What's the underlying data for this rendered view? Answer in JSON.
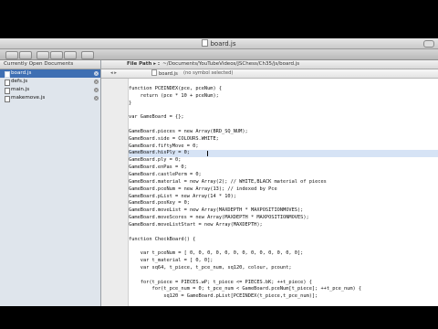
{
  "window": {
    "title": "board.js"
  },
  "sidebar": {
    "header": "Currently Open Documents",
    "files": [
      {
        "name": "board.js",
        "active": true
      },
      {
        "name": "defs.js",
        "active": false
      },
      {
        "name": "main.js",
        "active": false
      },
      {
        "name": "makemove.js",
        "active": false
      }
    ]
  },
  "editor": {
    "path_label": "File Path ▸ :",
    "path_value": "~/Documents/YouTubeVideos/JSChess/Ch35/js/board.js",
    "file_name": "board.js",
    "symbol": "(no symbol selected)",
    "highlight_line": 11,
    "lines": [
      {
        "n": "1",
        "t": ""
      },
      {
        "n": "2",
        "t": "function PCEINDEX(pce, pceNum) {"
      },
      {
        "n": "3",
        "t": "    return (pce * 10 + pceNum);"
      },
      {
        "n": "4",
        "t": "}"
      },
      {
        "n": "5",
        "t": ""
      },
      {
        "n": "6",
        "t": "var GameBoard = {};"
      },
      {
        "n": "7",
        "t": ""
      },
      {
        "n": "8",
        "t": "GameBoard.pieces = new Array(BRD_SQ_NUM);"
      },
      {
        "n": "9",
        "t": "GameBoard.side = COLOURS.WHITE;"
      },
      {
        "n": "10",
        "t": "GameBoard.fiftyMove = 0;"
      },
      {
        "n": "11",
        "t": "GameBoard.hisPly = 0;"
      },
      {
        "n": "12",
        "t": "GameBoard.ply = 0;"
      },
      {
        "n": "13",
        "t": "GameBoard.enPas = 0;"
      },
      {
        "n": "14",
        "t": "GameBoard.castlePerm = 0;"
      },
      {
        "n": "15",
        "t": "GameBoard.material = new Array(2); // WHITE,BLACK material of pieces"
      },
      {
        "n": "16",
        "t": "GameBoard.pceNum = new Array(13); // indexed by Pce"
      },
      {
        "n": "17",
        "t": "GameBoard.pList = new Array(14 * 10);"
      },
      {
        "n": "18",
        "t": "GameBoard.posKey = 0;"
      },
      {
        "n": "19",
        "t": "GameBoard.moveList = new Array(MAXDEPTH * MAXPOSITIONMOVES);"
      },
      {
        "n": "20",
        "t": "GameBoard.moveScores = new Array(MAXDEPTH * MAXPOSITIONMOVES);"
      },
      {
        "n": "21",
        "t": "GameBoard.moveListStart = new Array(MAXDEPTH);"
      },
      {
        "n": "22",
        "t": ""
      },
      {
        "n": "23",
        "t": "function CheckBoard() {"
      },
      {
        "n": "24",
        "t": ""
      },
      {
        "n": "25",
        "t": "    var t_pceNum = [ 0, 0, 0, 0, 0, 0, 0, 0, 0, 0, 0, 0, 0];"
      },
      {
        "n": "26",
        "t": "    var t_material = [ 0, 0];"
      },
      {
        "n": "27",
        "t": "    var sq64, t_piece, t_pce_num, sq120, colour, pcount;"
      },
      {
        "n": "28",
        "t": ""
      },
      {
        "n": "29",
        "t": "    for(t_piece = PIECES.wP; t_piece <= PIECES.bK; ++t_piece) {"
      },
      {
        "n": "30",
        "t": "        for(t_pce_num = 0; t_pce_num < GameBoard.pceNum[t_piece]; ++t_pce_num) {"
      },
      {
        "n": "31",
        "t": "            sq120 = GameBoard.pList[PCEINDEX(t_piece,t_pce_num)];"
      },
      {
        "n": "32",
        "t": ""
      }
    ]
  }
}
